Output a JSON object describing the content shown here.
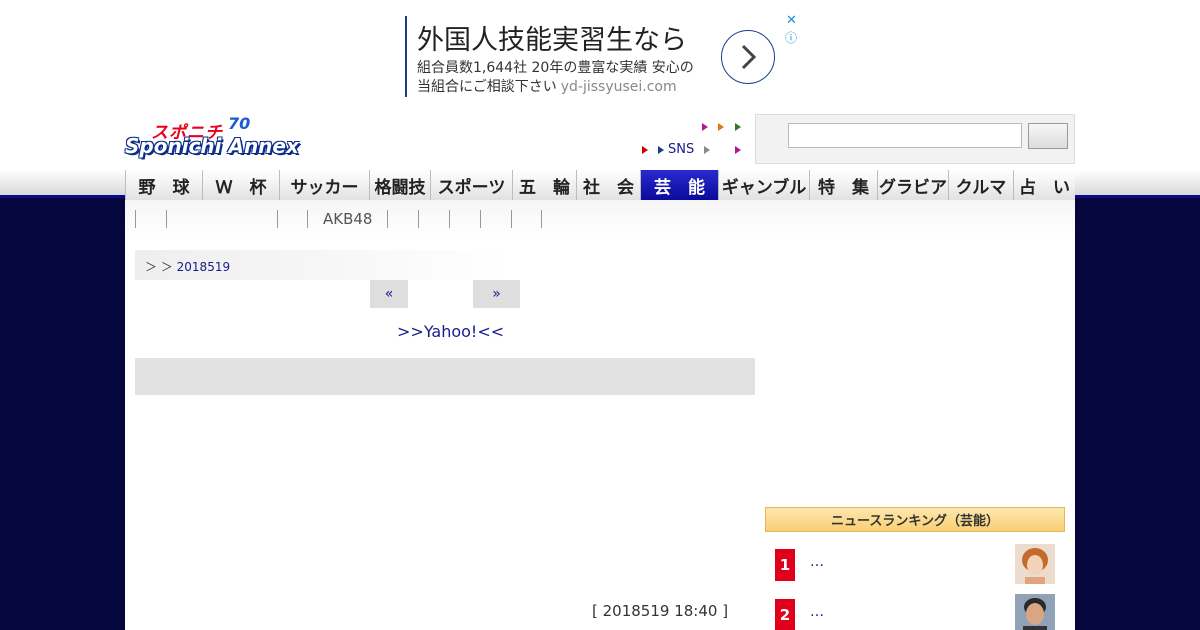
{
  "ad": {
    "headline": "外国人技能実習生なら",
    "line1": "組合員数1,644社 20年の豊富な実績 安心の",
    "line2": "当組合にご相談下さい",
    "url": "yd-jissyusei.com",
    "close_glyph": "✕",
    "info_glyph": "ⓘ"
  },
  "logo": {
    "line1": "スポニチ",
    "line2": "Sponichi Annex",
    "badge": "70"
  },
  "mini_nav": {
    "sns_label": "SNS"
  },
  "main_nav": [
    {
      "label": "野　球"
    },
    {
      "label": "Ｗ　杯"
    },
    {
      "label": "サッカー"
    },
    {
      "label": "格闘技"
    },
    {
      "label": "スポーツ"
    },
    {
      "label": "五　輪"
    },
    {
      "label": "社　会"
    },
    {
      "label": "芸　能"
    },
    {
      "label": "ギャンブル"
    },
    {
      "label": "特　集"
    },
    {
      "label": "グラビア"
    },
    {
      "label": "クルマ"
    },
    {
      "label": "占　い"
    }
  ],
  "sub_nav": {
    "label": "AKB48"
  },
  "breadcrumb": {
    "prefix": "＞ ＞",
    "date_link": "2018519"
  },
  "pager": {
    "prev": "«",
    "next": "»"
  },
  "yahoo_link": ">>Yahoo!<<",
  "timestamp": "[ 2018519 18:40 ]",
  "ranking": {
    "header": "ニュースランキング（芸能）",
    "items": [
      {
        "rank": "1",
        "title": "…"
      },
      {
        "rank": "2",
        "title": "…"
      }
    ]
  },
  "colors": {
    "navy_bg": "#06063f",
    "nav_active": "#0a0a9a",
    "rank_red": "#e0001b",
    "link": "#1a1a8a"
  }
}
